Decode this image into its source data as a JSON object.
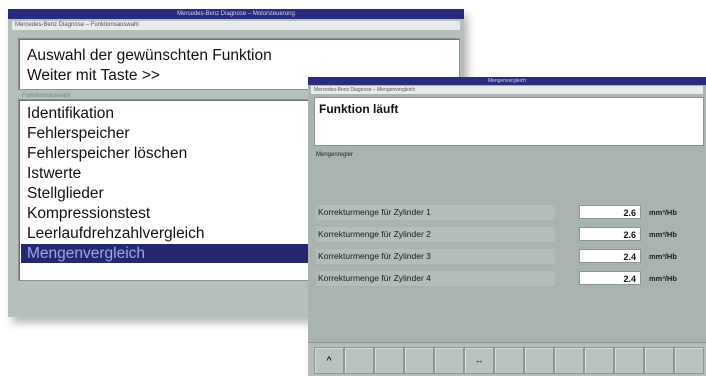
{
  "back_window": {
    "title": "Mercedes-Benz Diagnose – Motorsteuerung",
    "subtitle": "Mercedes-Benz Diagnose – Funktionsauswahl",
    "message": {
      "line1": "Auswahl der gewünschten Funktion",
      "line2": "Weiter mit Taste >>"
    },
    "section_label": "Funktionsauswahl",
    "functions": [
      {
        "label": "Identifikation"
      },
      {
        "label": "Fehlerspeicher"
      },
      {
        "label": "Fehlerspeicher löschen"
      },
      {
        "label": "Istwerte"
      },
      {
        "label": "Stellglieder"
      },
      {
        "label": "Kompressionstest"
      },
      {
        "label": "Leerlaufdrehzahlvergleich"
      },
      {
        "label": "Mengenvergleich",
        "selected": true
      }
    ]
  },
  "front_window": {
    "title": "Mengenvergleich",
    "subtitle": "Mercedes-Benz Diagnose – Mengenvergleich",
    "status": "Funktion läuft",
    "section_label": "Mengenregler",
    "rows": [
      {
        "label": "Korrekturmenge für Zylinder 1",
        "value": "2.6",
        "unit": "mm³/Hb"
      },
      {
        "label": "Korrekturmenge für Zylinder 2",
        "value": "2.6",
        "unit": "mm³/Hb"
      },
      {
        "label": "Korrekturmenge für Zylinder 3",
        "value": "2.4",
        "unit": "mm³/Hb"
      },
      {
        "label": "Korrekturmenge für Zylinder 4",
        "value": "2.4",
        "unit": "mm³/Hb"
      }
    ],
    "buttons": [
      {
        "label": "^"
      },
      {
        "label": ""
      },
      {
        "label": ""
      },
      {
        "label": ""
      },
      {
        "label": ""
      },
      {
        "label": "↔"
      },
      {
        "label": ""
      },
      {
        "label": ""
      },
      {
        "label": ""
      },
      {
        "label": ""
      },
      {
        "label": ""
      },
      {
        "label": ""
      },
      {
        "label": ""
      }
    ]
  }
}
